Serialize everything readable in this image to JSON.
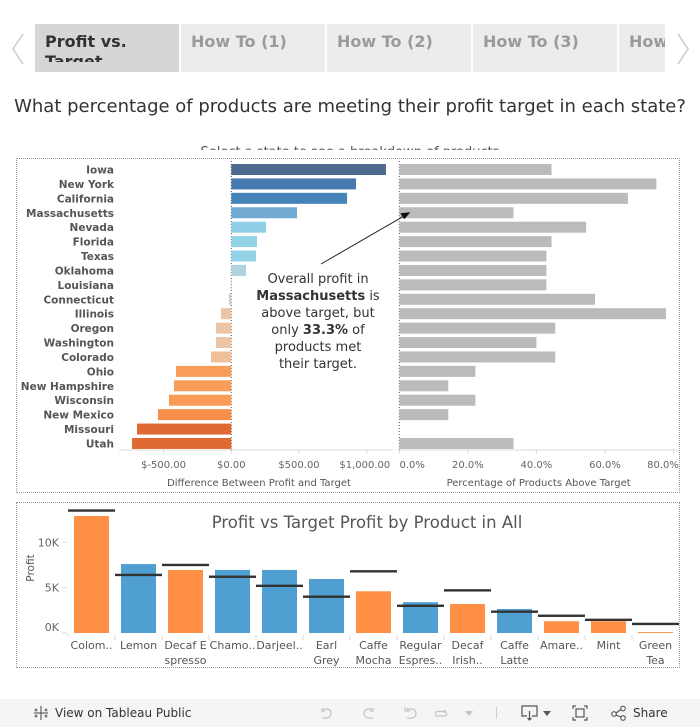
{
  "tabs": {
    "items": [
      {
        "label": "Profit vs. Target",
        "active": true
      },
      {
        "label": "How To (1)",
        "active": false
      },
      {
        "label": "How To (2)",
        "active": false
      },
      {
        "label": "How To (3)",
        "active": false
      },
      {
        "label": "How",
        "active": false
      }
    ]
  },
  "header": {
    "title": "What percentage of products are meeting their profit target in each state?",
    "subtitle": "Select a state to see a breakdown of products"
  },
  "annotation": {
    "line1": "Overall profit in",
    "bold1": "Massachusetts",
    "after1": " is",
    "line3": "above target, but",
    "before2": "only ",
    "bold2": "33.3%",
    "after2": " of",
    "line5": "products met",
    "line6": "their target."
  },
  "chart_data": [
    {
      "type": "bar",
      "orientation": "horizontal",
      "categories": [
        "Iowa",
        "New York",
        "California",
        "Massachusetts",
        "Nevada",
        "Florida",
        "Texas",
        "Oklahoma",
        "Louisiana",
        "Connecticut",
        "Illinois",
        "Oregon",
        "Washington",
        "Colorado",
        "Ohio",
        "New Hampshire",
        "Wisconsin",
        "New Mexico",
        "Missouri",
        "Utah"
      ],
      "series": [
        {
          "name": "Difference Between Profit and Target",
          "values": [
            1142,
            921,
            855,
            485,
            256,
            190,
            182,
            109,
            2,
            -17,
            -76,
            -113,
            -113,
            -150,
            -408,
            -423,
            -460,
            -541,
            -696,
            -733
          ],
          "colors": [
            "#4d6a8e",
            "#4579b0",
            "#4683b8",
            "#70aad3",
            "#8ecfe7",
            "#93d3e8",
            "#93d3e8",
            "#b0d3e0",
            "#d2d2d2",
            "#d9ccc4",
            "#ecc4a8",
            "#ecc4a6",
            "#ecc4a6",
            "#efc09a",
            "#f79d58",
            "#f79d58",
            "#f79b55",
            "#f58f4a",
            "#e06a33",
            "#e06a33"
          ]
        },
        {
          "name": "Percentage of Products Above Target",
          "values": [
            44.4,
            75.0,
            66.7,
            33.3,
            54.5,
            44.4,
            42.9,
            42.9,
            42.9,
            57.1,
            77.8,
            45.5,
            40.0,
            45.5,
            22.2,
            14.3,
            22.2,
            14.3,
            0.0,
            33.3
          ],
          "color": "#bbbbbb"
        }
      ],
      "axes": [
        {
          "label": "Difference Between Profit and Target",
          "ticks": [
            -500,
            0,
            500,
            1000
          ],
          "tick_labels": [
            "$-500.00",
            "$0.00",
            "$500.00",
            "$1,000.00"
          ],
          "range": [
            -829,
            1194
          ]
        },
        {
          "label": "Percentage of Products Above Target",
          "ticks": [
            0,
            20,
            40,
            60,
            80
          ],
          "tick_labels": [
            "0.0%",
            "20.0%",
            "40.0%",
            "60.0%",
            "80.0%"
          ],
          "range": [
            0,
            81.3
          ]
        }
      ],
      "annotation_target": "Massachusetts",
      "grid": false
    },
    {
      "type": "bar",
      "title": "Profit vs Target Profit by Product in All",
      "xlabel": "",
      "ylabel": "Profit",
      "categories": [
        [
          "Colom.."
        ],
        [
          "Lemon"
        ],
        [
          "Decaf E",
          "spresso"
        ],
        [
          "Chamo.."
        ],
        [
          "Darjeel.."
        ],
        [
          "Earl",
          "Grey"
        ],
        [
          "Caffe",
          "Mocha"
        ],
        [
          "Regular",
          "Espres.."
        ],
        [
          "Decaf",
          "Irish.."
        ],
        [
          "Caffe",
          "Latte"
        ],
        [
          "Amare.."
        ],
        [
          "Mint"
        ],
        [
          "Green",
          "Tea"
        ]
      ],
      "series": [
        {
          "name": "Profit",
          "values": [
            12900,
            7600,
            6950,
            6950,
            6950,
            5950,
            4600,
            3400,
            3200,
            2650,
            1300,
            1300,
            100
          ]
        },
        {
          "name": "Target Profit",
          "values": [
            13500,
            6400,
            7500,
            6200,
            5200,
            4000,
            6800,
            3000,
            4700,
            2350,
            1900,
            1450,
            1000
          ],
          "mark": "reference-line",
          "color": "#333333"
        }
      ],
      "bar_colors": [
        "#ff9045",
        "#4f9fd3",
        "#ff9045",
        "#4f9fd3",
        "#4f9fd3",
        "#4f9fd3",
        "#ff9045",
        "#4f9fd3",
        "#ff9045",
        "#4f9fd3",
        "#ff9045",
        "#ff9045",
        "#ff9045"
      ],
      "y_ticks": [
        0,
        5000,
        10000
      ],
      "y_tick_labels": [
        "0K",
        "5K",
        "10K"
      ],
      "ylim": [
        0,
        14000
      ],
      "grid": false
    }
  ],
  "footer": {
    "view_label": "View on Tableau Public",
    "share_label": "Share"
  }
}
